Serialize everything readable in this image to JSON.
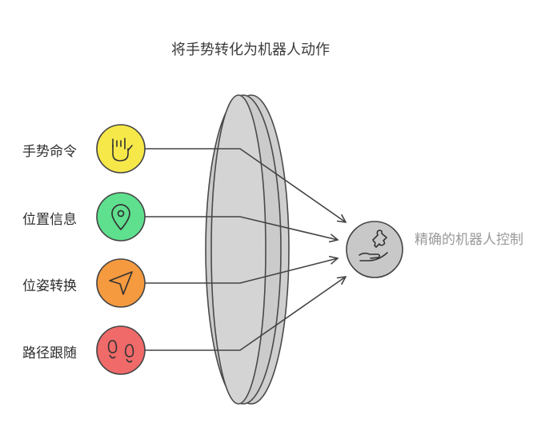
{
  "title": "将手势转化为机器人动作",
  "inputs": [
    {
      "label": "手势命令",
      "icon": "hand-gesture-icon",
      "color": "#f7e84a"
    },
    {
      "label": "位置信息",
      "icon": "map-pin-icon",
      "color": "#5fe08e"
    },
    {
      "label": "位姿转换",
      "icon": "navigation-arrow-icon",
      "color": "#f59a3f"
    },
    {
      "label": "路径跟随",
      "icon": "footprints-icon",
      "color": "#f06a6a"
    }
  ],
  "output": {
    "label": "精确的机器人控制",
    "icon": "puzzle-hand-icon",
    "color": "#c8c8c8"
  }
}
